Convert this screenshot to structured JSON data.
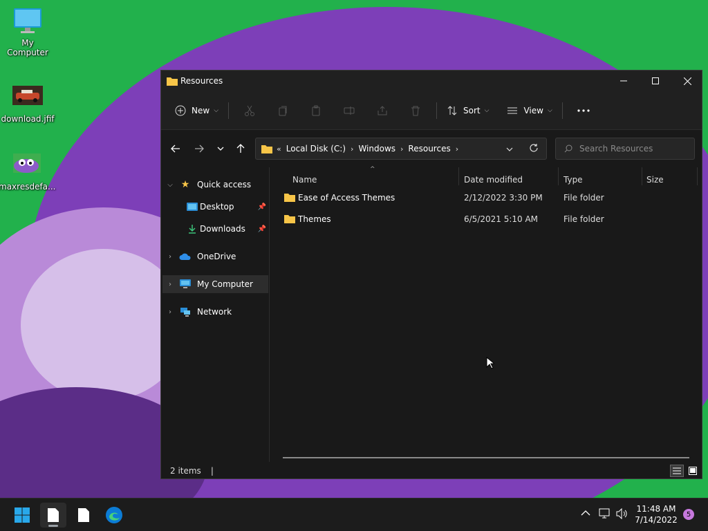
{
  "desktop": {
    "icons": [
      {
        "label": "My Computer"
      },
      {
        "label": "download.jfif"
      },
      {
        "label": "maxresdefa..."
      }
    ]
  },
  "window": {
    "title": "Resources",
    "toolbar": {
      "new_label": "New",
      "sort_label": "Sort",
      "view_label": "View"
    },
    "address": {
      "crumbs": [
        "Local Disk (C:)",
        "Windows",
        "Resources"
      ],
      "overflow": "«"
    },
    "search": {
      "placeholder": "Search Resources"
    },
    "nav": {
      "quick_access": "Quick access",
      "desktop": "Desktop",
      "downloads": "Downloads",
      "onedrive": "OneDrive",
      "my_computer": "My Computer",
      "network": "Network"
    },
    "columns": {
      "name": "Name",
      "date": "Date modified",
      "type": "Type",
      "size": "Size"
    },
    "files": [
      {
        "name": "Ease of Access Themes",
        "date": "2/12/2022 3:30 PM",
        "type": "File folder"
      },
      {
        "name": "Themes",
        "date": "6/5/2021 5:10 AM",
        "type": "File folder"
      }
    ],
    "status": {
      "count": "2 items",
      "cursor": "|"
    }
  },
  "taskbar": {
    "time": "11:48 AM",
    "date": "7/14/2022",
    "badge": "5"
  },
  "colors": {
    "accent": "#0078d4",
    "folder": "#f7c548",
    "desktop_green": "#22b14c",
    "purple": "#8a4fc0"
  }
}
